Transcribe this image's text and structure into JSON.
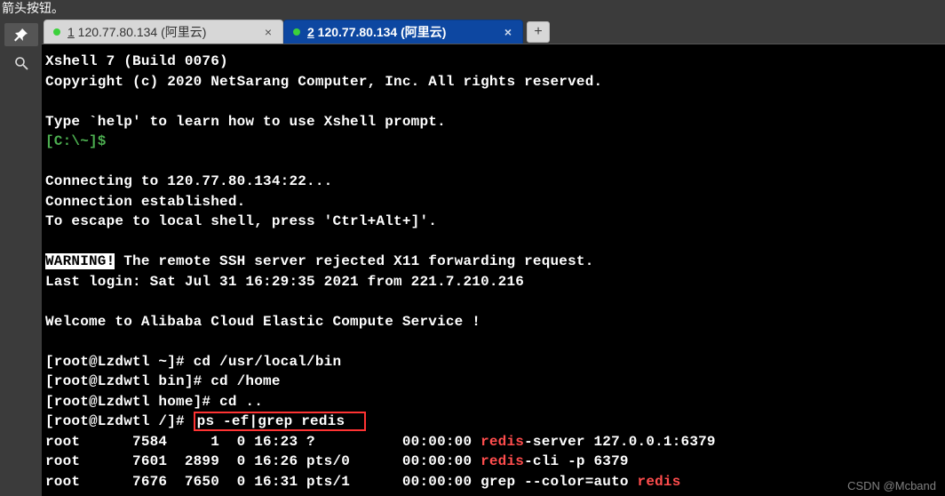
{
  "top_hint_text": "箭头按钮。",
  "tabs": [
    {
      "num": "1",
      "label": " 120.77.80.134  (阿里云)",
      "active": false
    },
    {
      "num": "2",
      "label": " 120.77.80.134  (阿里云)",
      "active": true
    }
  ],
  "terminal": {
    "line_app": "Xshell 7 (Build 0076)",
    "line_copyright": "Copyright (c) 2020 NetSarang Computer, Inc. All rights reserved.",
    "line_help": "Type `help' to learn how to use Xshell prompt.",
    "prompt_local": "[C:\\~]$",
    "line_connecting": "Connecting to 120.77.80.134:22...",
    "line_connest": "Connection established.",
    "line_escape": "To escape to local shell, press 'Ctrl+Alt+]'.",
    "warning_label": "WARNING!",
    "warning_rest": " The remote SSH server rejected X11 forwarding request.",
    "last_login": "Last login: Sat Jul 31 16:29:35 2021 from 221.7.210.216",
    "welcome": "Welcome to Alibaba Cloud Elastic Compute Service !",
    "p1_prompt": "[root@Lzdwtl ~]# ",
    "p1_cmd": "cd /usr/local/bin",
    "p2_prompt": "[root@Lzdwtl bin]# ",
    "p2_cmd": "cd /home",
    "p3_prompt": "[root@Lzdwtl home]# ",
    "p3_cmd": "cd ..",
    "p4_prompt": "[root@Lzdwtl /]# ",
    "p4_cmd": "ps -ef|grep redis  ",
    "ps_rows": [
      {
        "user": "root",
        "pid": "7584",
        "ppid": "1",
        "c": "0",
        "stime": "16:23",
        "tty": "?",
        "time": "00:00:00",
        "cmd_pre": "",
        "cmd_hl": "redis",
        "cmd_post": "-server 127.0.0.1:6379"
      },
      {
        "user": "root",
        "pid": "7601",
        "ppid": "2899",
        "c": "0",
        "stime": "16:26",
        "tty": "pts/0",
        "time": "00:00:00",
        "cmd_pre": "",
        "cmd_hl": "redis",
        "cmd_post": "-cli -p 6379"
      },
      {
        "user": "root",
        "pid": "7676",
        "ppid": "7650",
        "c": "0",
        "stime": "16:31",
        "tty": "pts/1",
        "time": "00:00:00",
        "cmd_pre": "grep --color=auto ",
        "cmd_hl": "redis",
        "cmd_post": ""
      }
    ]
  },
  "watermark": "CSDN @Mcband"
}
